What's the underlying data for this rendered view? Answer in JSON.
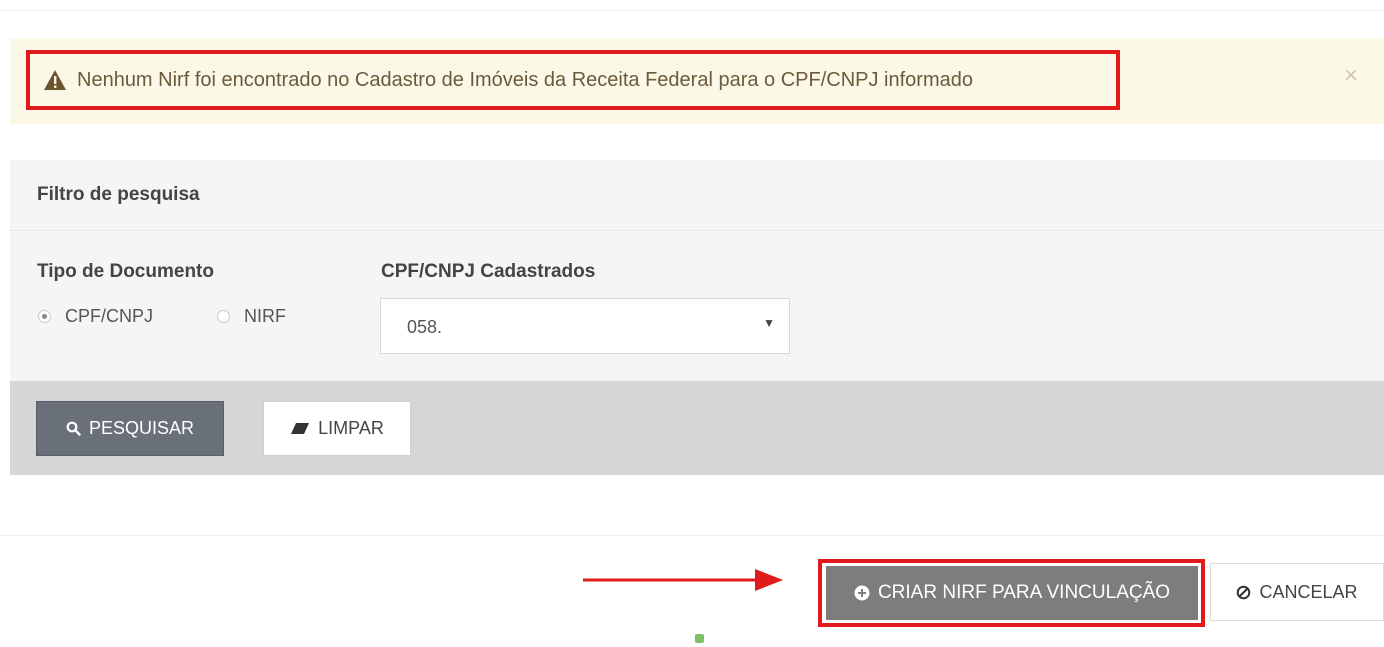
{
  "alert": {
    "message": "Nenhum Nirf foi encontrado no Cadastro de Imóveis da Receita Federal para o CPF/CNPJ informado",
    "close_label": "×",
    "icon": "warning-triangle-icon"
  },
  "filter": {
    "title": "Filtro de pesquisa",
    "document_type_label": "Tipo de Documento",
    "options": [
      {
        "label": "CPF/CNPJ",
        "checked": true
      },
      {
        "label": "NIRF",
        "checked": false
      }
    ],
    "cpf_label": "CPF/CNPJ Cadastrados",
    "cpf_selected": "058.",
    "search_label": "PESQUISAR",
    "clear_label": "LIMPAR"
  },
  "actions": {
    "create_label": "CRIAR NIRF PARA VINCULAÇÃO",
    "cancel_label": "CANCELAR"
  },
  "colors": {
    "highlight": "#e01b1b",
    "alert_bg": "#fcf8e8",
    "search_button": "#69707a",
    "create_button": "#7d7d7d"
  }
}
